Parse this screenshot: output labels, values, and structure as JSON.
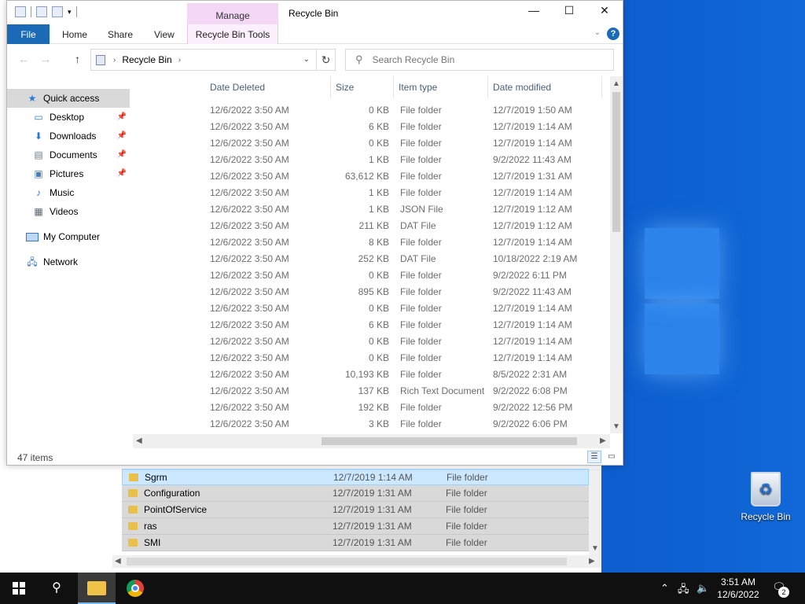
{
  "window": {
    "title": "Recycle Bin",
    "contextual_tab_group": "Manage",
    "minimize_glyph": "—",
    "maximize_glyph": "☐",
    "close_glyph": "✕"
  },
  "ribbon": {
    "tabs": [
      "File",
      "Home",
      "Share",
      "View",
      "Recycle Bin Tools"
    ],
    "help_glyph": "?"
  },
  "address": {
    "path": "Recycle Bin",
    "search_placeholder": "Search Recycle Bin"
  },
  "sidebar": {
    "quick_access": "Quick access",
    "items": [
      {
        "label": "Desktop",
        "icon": "desktop-icon",
        "pinned": true
      },
      {
        "label": "Downloads",
        "icon": "download-arrow-icon",
        "pinned": true
      },
      {
        "label": "Documents",
        "icon": "documents-icon",
        "pinned": true
      },
      {
        "label": "Pictures",
        "icon": "pictures-icon",
        "pinned": true
      },
      {
        "label": "Music",
        "icon": "music-note-icon",
        "pinned": false
      },
      {
        "label": "Videos",
        "icon": "videos-icon",
        "pinned": false
      }
    ],
    "my_computer": "My Computer",
    "network": "Network"
  },
  "columns": [
    "Date Deleted",
    "Size",
    "Item type",
    "Date modified"
  ],
  "rows": [
    [
      "12/6/2022 3:50 AM",
      "0 KB",
      "File folder",
      "12/7/2019 1:50 AM"
    ],
    [
      "12/6/2022 3:50 AM",
      "6 KB",
      "File folder",
      "12/7/2019 1:14 AM"
    ],
    [
      "12/6/2022 3:50 AM",
      "0 KB",
      "File folder",
      "12/7/2019 1:14 AM"
    ],
    [
      "12/6/2022 3:50 AM",
      "1 KB",
      "File folder",
      "9/2/2022 11:43 AM"
    ],
    [
      "12/6/2022 3:50 AM",
      "63,612 KB",
      "File folder",
      "12/7/2019 1:31 AM"
    ],
    [
      "12/6/2022 3:50 AM",
      "1 KB",
      "File folder",
      "12/7/2019 1:14 AM"
    ],
    [
      "12/6/2022 3:50 AM",
      "1 KB",
      "JSON File",
      "12/7/2019 1:12 AM"
    ],
    [
      "12/6/2022 3:50 AM",
      "211 KB",
      "DAT File",
      "12/7/2019 1:12 AM"
    ],
    [
      "12/6/2022 3:50 AM",
      "8 KB",
      "File folder",
      "12/7/2019 1:14 AM"
    ],
    [
      "12/6/2022 3:50 AM",
      "252 KB",
      "DAT File",
      "10/18/2022 2:19 AM"
    ],
    [
      "12/6/2022 3:50 AM",
      "0 KB",
      "File folder",
      "9/2/2022 6:11 PM"
    ],
    [
      "12/6/2022 3:50 AM",
      "895 KB",
      "File folder",
      "9/2/2022 11:43 AM"
    ],
    [
      "12/6/2022 3:50 AM",
      "0 KB",
      "File folder",
      "12/7/2019 1:14 AM"
    ],
    [
      "12/6/2022 3:50 AM",
      "6 KB",
      "File folder",
      "12/7/2019 1:14 AM"
    ],
    [
      "12/6/2022 3:50 AM",
      "0 KB",
      "File folder",
      "12/7/2019 1:14 AM"
    ],
    [
      "12/6/2022 3:50 AM",
      "0 KB",
      "File folder",
      "12/7/2019 1:14 AM"
    ],
    [
      "12/6/2022 3:50 AM",
      "10,193 KB",
      "File folder",
      "8/5/2022 2:31 AM"
    ],
    [
      "12/6/2022 3:50 AM",
      "137 KB",
      "Rich Text Document",
      "9/2/2022 6:08 PM"
    ],
    [
      "12/6/2022 3:50 AM",
      "192 KB",
      "File folder",
      "9/2/2022 12:56 PM"
    ],
    [
      "12/6/2022 3:50 AM",
      "3 KB",
      "File folder",
      "9/2/2022 6:06 PM"
    ]
  ],
  "status": {
    "item_count": "47 items"
  },
  "background_window": {
    "rows": [
      [
        "Sgrm",
        "12/7/2019 1:14 AM",
        "File folder"
      ],
      [
        "Configuration",
        "12/7/2019 1:31 AM",
        "File folder"
      ],
      [
        "PointOfService",
        "12/7/2019 1:31 AM",
        "File folder"
      ],
      [
        "ras",
        "12/7/2019 1:31 AM",
        "File folder"
      ],
      [
        "SMI",
        "12/7/2019 1:31 AM",
        "File folder"
      ]
    ]
  },
  "desktop": {
    "icon_label": "Recycle Bin"
  },
  "taskbar": {
    "time": "3:51 AM",
    "date": "12/6/2022",
    "notification_count": "2"
  },
  "colors": {
    "accent": "#1a6ab8",
    "manage_tab": "#f3d7f5",
    "selection": "#cce8ff",
    "desktop": "#0a56c7"
  }
}
